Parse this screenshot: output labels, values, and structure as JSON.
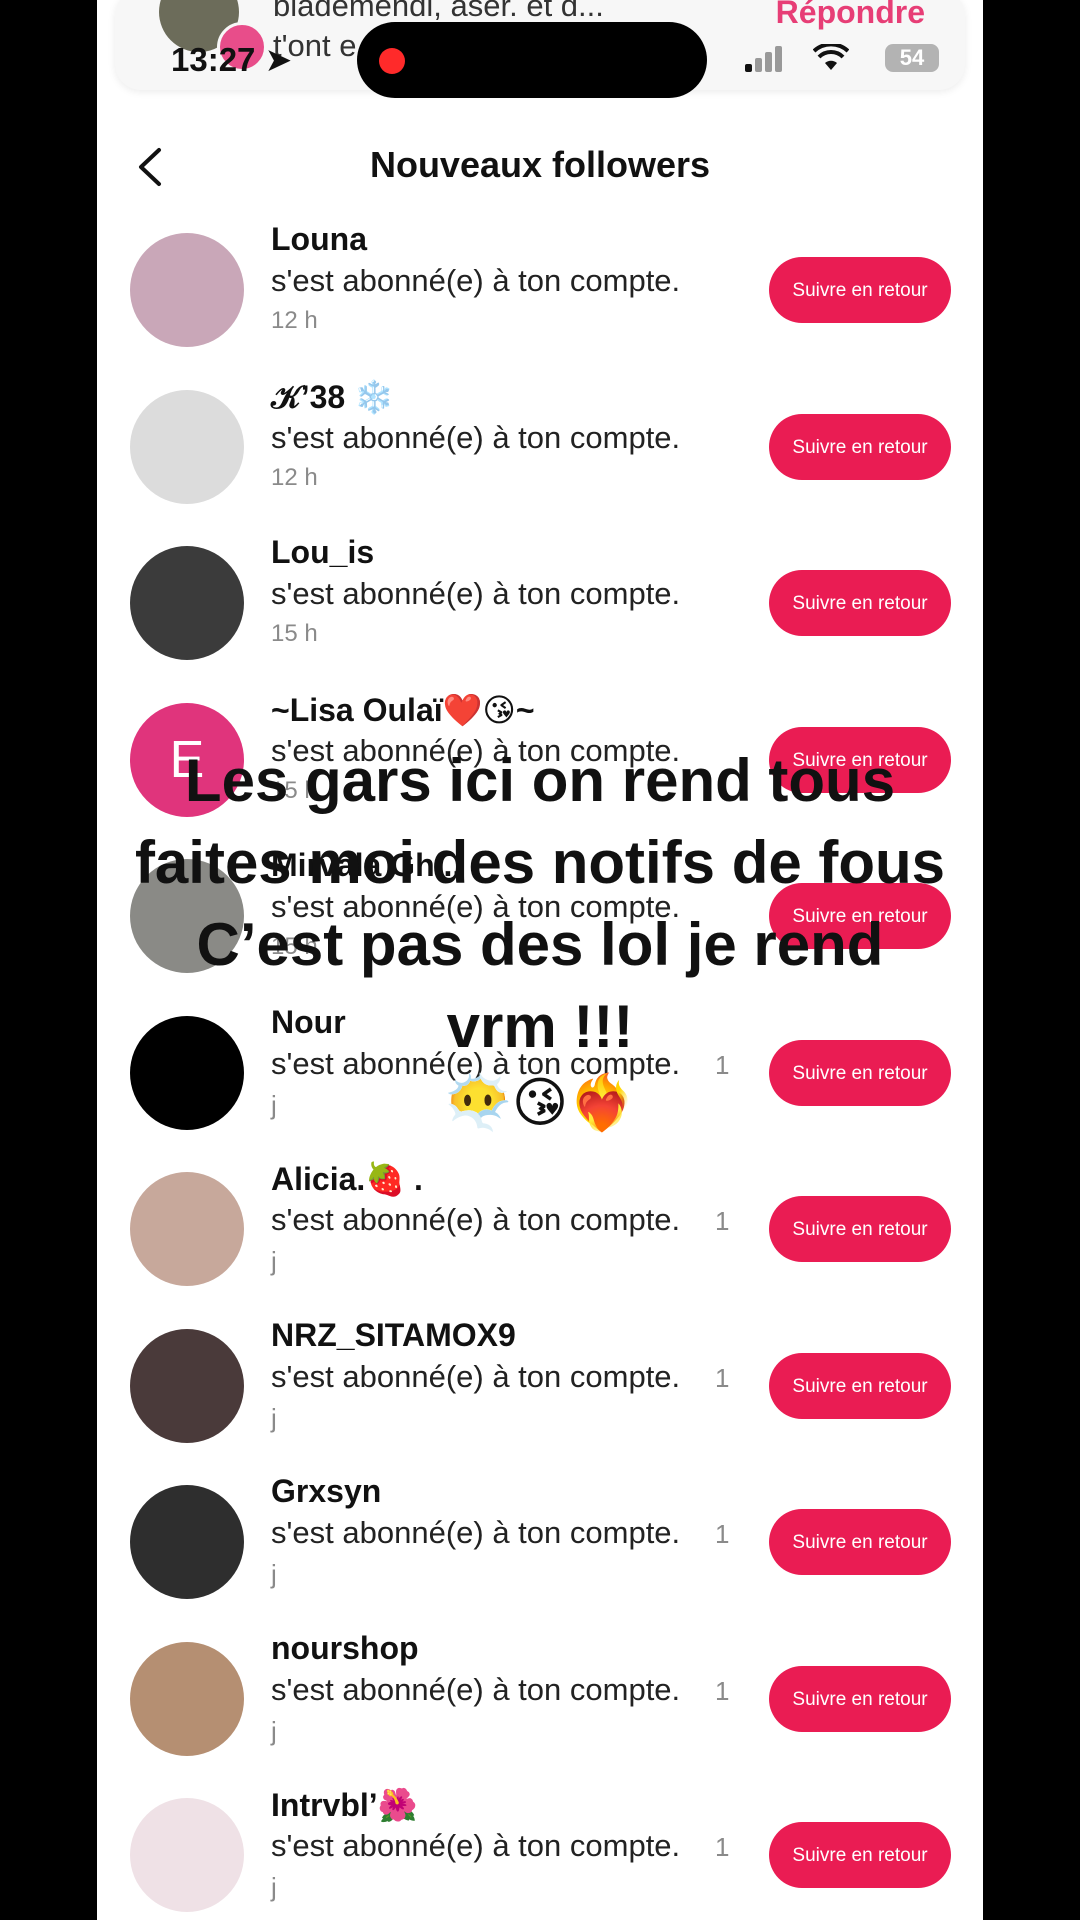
{
  "status": {
    "time": "13:27",
    "battery": "54"
  },
  "banner": {
    "text_line1": "blademendi, aser. et d...",
    "text_line2": "t'ont e... ...e...",
    "reply": "Répondre"
  },
  "header": {
    "title": "Nouveaux followers"
  },
  "rows": [
    {
      "name": "Louna",
      "action": "s'est abonné(e) à ton compte.",
      "time": "12 h",
      "button": "Suivre en retour",
      "avatar_color": "#c9a7b8"
    },
    {
      "name": "𝒦’38 ❄️",
      "action": "s'est abonné(e) à ton compte.",
      "time": "12 h",
      "button": "Suivre en retour",
      "avatar_color": "#dcdcdc"
    },
    {
      "name": "Lou_is",
      "action": "s'est abonné(e) à ton compte.",
      "time": "15 h",
      "button": "Suivre en retour",
      "avatar_color": "#3b3b3b"
    },
    {
      "name": "~Lisa Oulaï❤️😘~",
      "action": "s'est abonné(e) à ton compte.",
      "time": "15 h",
      "button": "Suivre en retour",
      "avatar_color": "#e0347c",
      "avatar_letter": "E"
    },
    {
      "name": "Mirvala Gh...",
      "action": "s'est abonné(e) à ton compte.",
      "time": "15 h",
      "button": "Suivre en retour",
      "avatar_color": "#8a8a86"
    },
    {
      "name": "Nour",
      "action": "s'est abonné(e) à ton compte.",
      "time": "1",
      "time2": "j",
      "button": "Suivre en retour",
      "avatar_color": "#000000"
    },
    {
      "name": "Alicia.🍓 .",
      "action": "s'est abonné(e) à ton compte.",
      "time": "1",
      "time2": "j",
      "button": "Suivre en retour",
      "avatar_color": "#c7a89b"
    },
    {
      "name": "NRZ_SITAMOX9",
      "action": "s'est abonné(e) à ton compte.",
      "time": "1",
      "time2": "j",
      "button": "Suivre en retour",
      "avatar_color": "#4a3a3a"
    },
    {
      "name": "Grxsyn",
      "action": "s'est abonné(e) à ton compte.",
      "time": "1",
      "time2": "j",
      "button": "Suivre en retour",
      "avatar_color": "#2e2e2e"
    },
    {
      "name": "nourshop",
      "action": "s'est abonné(e) à ton compte.",
      "time": "1",
      "time2": "j",
      "button": "Suivre en retour",
      "avatar_color": "#b58f72"
    },
    {
      "name": "Intrvbl’🌺",
      "action": "s'est abonné(e) à ton compte.",
      "time": "1",
      "time2": "j",
      "button": "Suivre en retour",
      "avatar_color": "#efe1e6"
    }
  ],
  "overlay": {
    "line1": "Les gars ici on rend tous",
    "line2": "faites moi des notifs de fous",
    "line3": "C’est pas des lol je rend",
    "line4": "vrm !!!",
    "emojis": "😶‍🌫️😘❤️‍🔥"
  },
  "colors": {
    "accent": "#ea1c53",
    "reply": "#e73e76"
  }
}
